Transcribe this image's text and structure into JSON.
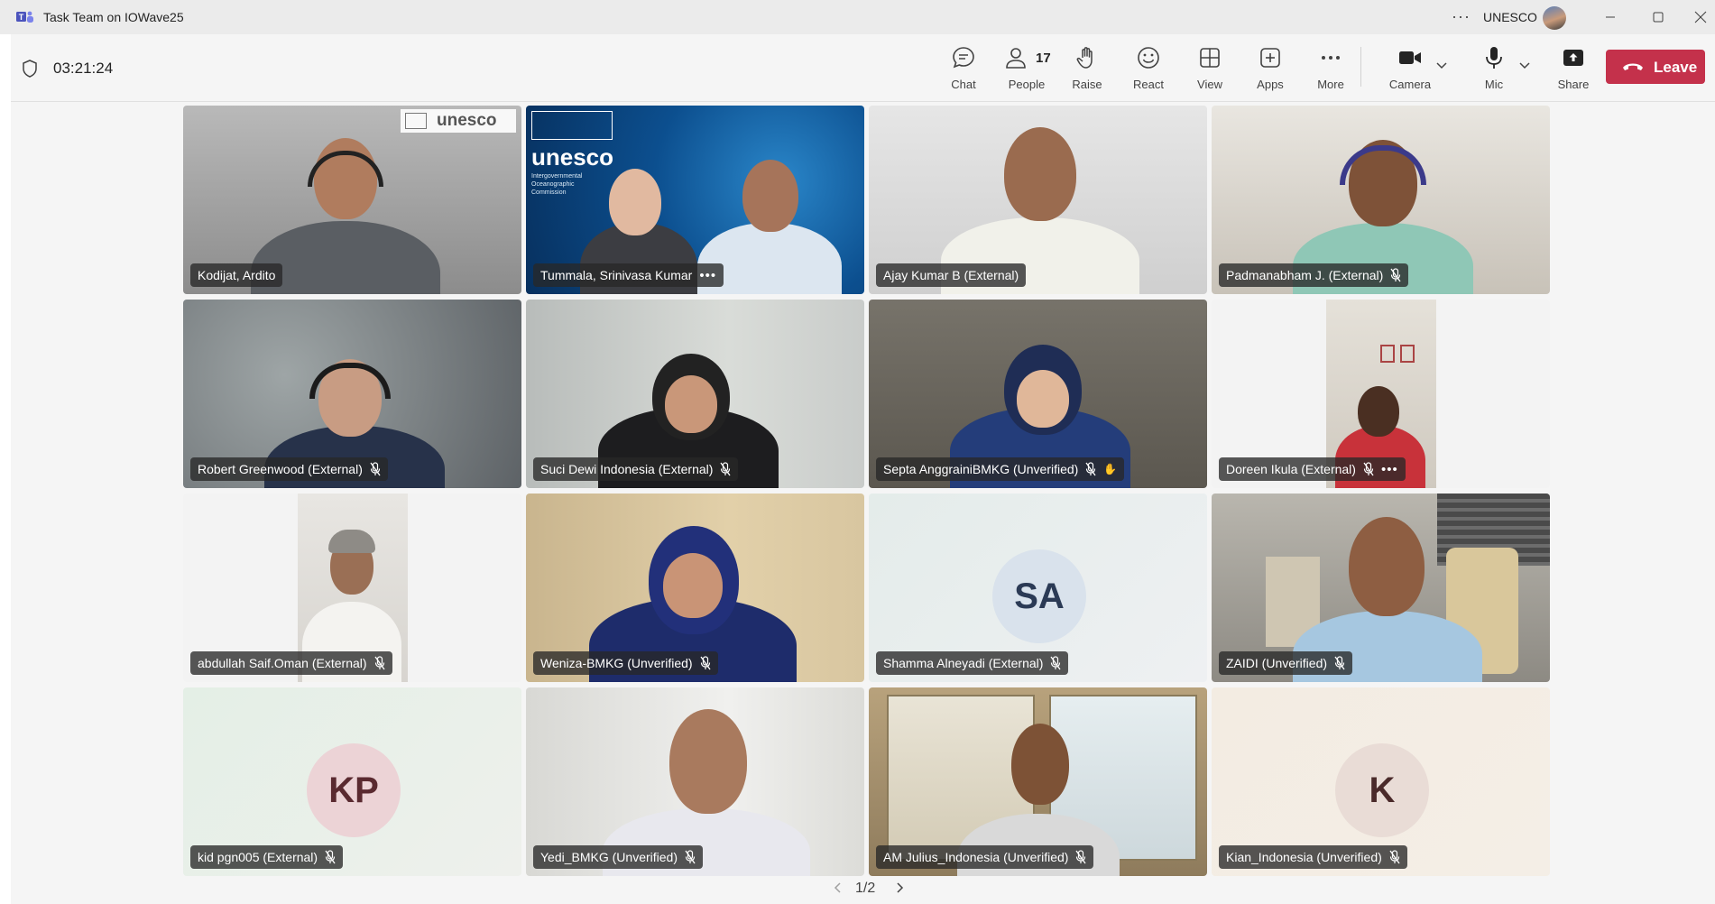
{
  "window": {
    "title": "Task Team on IOWave25",
    "more_glyph": "···",
    "org": "UNESCO",
    "icons": [
      "teams-logo-icon",
      "more-icon",
      "avatar",
      "minimize-icon",
      "maximize-icon",
      "close-icon"
    ]
  },
  "meeting": {
    "timer": "03:21:24",
    "toolbar": {
      "chat": "Chat",
      "people": "People",
      "people_count": "17",
      "raise": "Raise",
      "react": "React",
      "view": "View",
      "apps": "Apps",
      "more": "More",
      "camera": "Camera",
      "mic": "Mic",
      "share": "Share",
      "leave": "Leave"
    },
    "colors": {
      "leave": "#c4314b",
      "accent": "#5b5fc7"
    }
  },
  "tiles": [
    {
      "name": "Kodijat, Ardito",
      "muted": false,
      "more": false,
      "watermark": "unesco"
    },
    {
      "name": "Tummala, Srinivasa Kumar",
      "muted": false,
      "more": true,
      "banner": "unesco",
      "banner_sub": "Intergovernmental\nOceanographic\nCommission"
    },
    {
      "name": "Ajay Kumar B (External)",
      "muted": false,
      "more": false
    },
    {
      "name": "Padmanabham J. (External)",
      "muted": true,
      "more": false
    },
    {
      "name": "Robert Greenwood (External)",
      "muted": true,
      "more": false
    },
    {
      "name": "Suci Dewi Indonesia (External)",
      "muted": true,
      "more": false
    },
    {
      "name": "Septa AnggrainiBMKG (Unverified)",
      "muted": true,
      "more": false
    },
    {
      "name": "Doreen Ikula (External)",
      "muted": true,
      "more": true
    },
    {
      "name": "abdullah Saif.Oman (External)",
      "muted": true,
      "more": false
    },
    {
      "name": "Weniza-BMKG (Unverified)",
      "muted": true,
      "more": false
    },
    {
      "name": "Shamma Alneyadi (External)",
      "muted": true,
      "more": false,
      "initials": "SA"
    },
    {
      "name": "ZAIDI (Unverified)",
      "muted": true,
      "more": false
    },
    {
      "name": "kid pgn005 (External)",
      "muted": true,
      "more": false,
      "initials": "KP"
    },
    {
      "name": "Yedi_BMKG (Unverified)",
      "muted": true,
      "more": false
    },
    {
      "name": "AM Julius_Indonesia (Unverified)",
      "muted": true,
      "more": false
    },
    {
      "name": "Kian_Indonesia (Unverified)",
      "muted": true,
      "more": false,
      "initials": "K"
    }
  ],
  "pager": {
    "label": "1/2"
  }
}
